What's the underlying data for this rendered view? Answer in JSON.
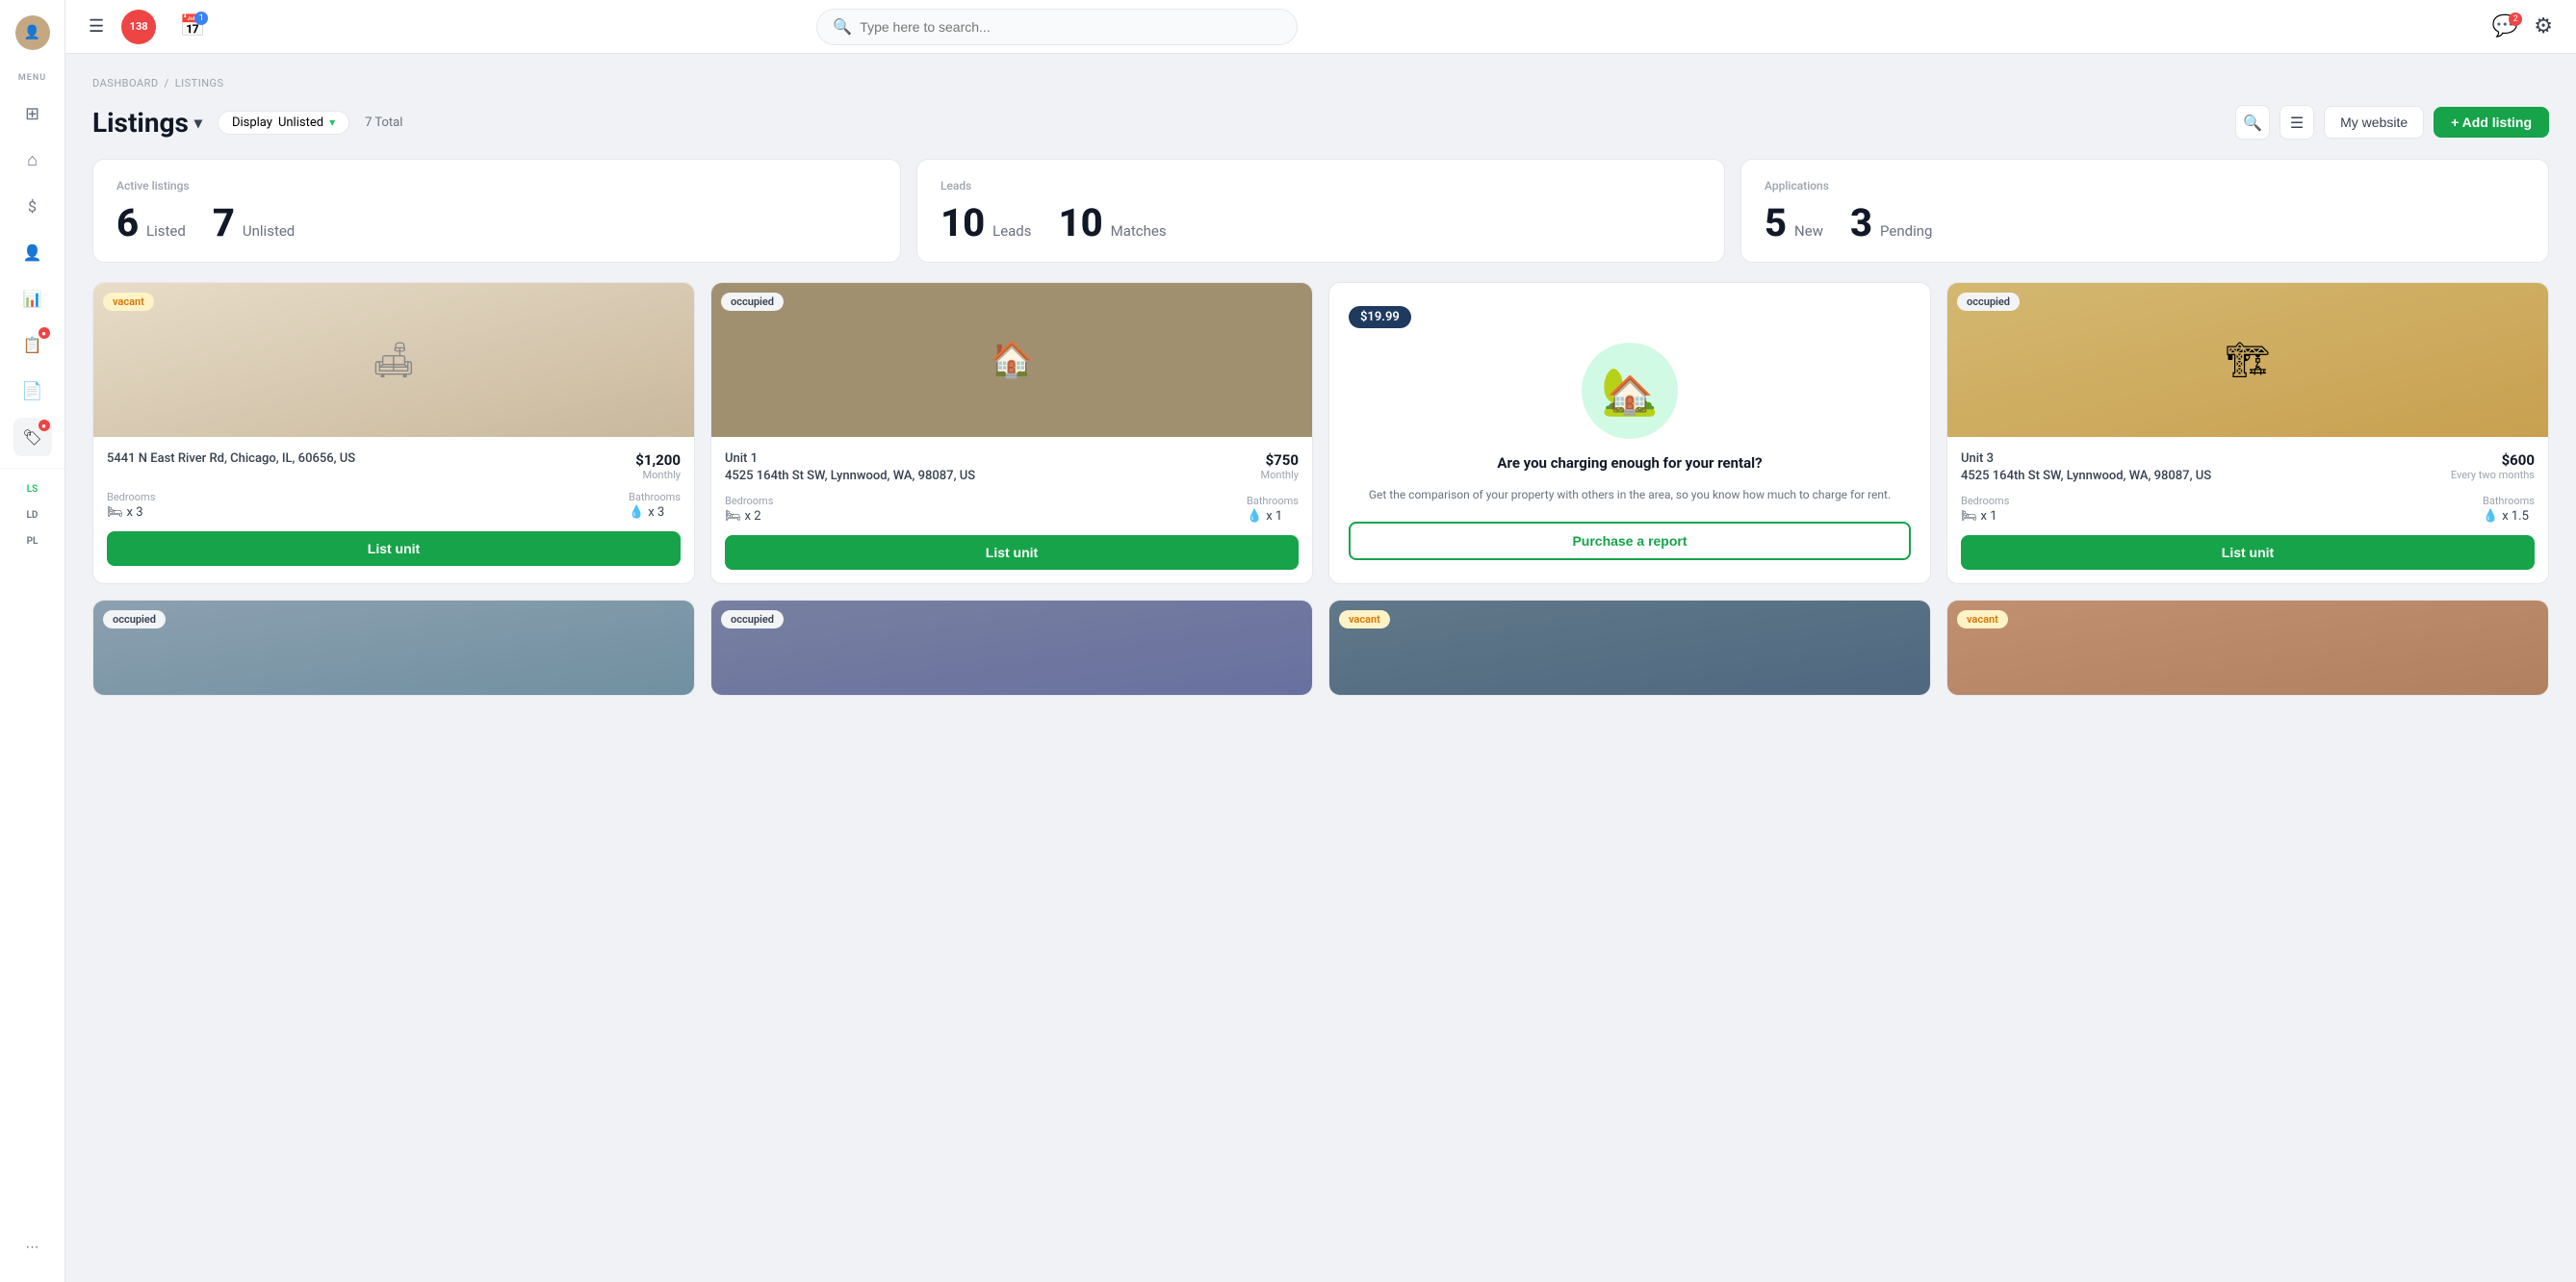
{
  "topbar": {
    "hamburger_label": "☰",
    "alert_count": "138",
    "calendar_badge": "1",
    "search_placeholder": "Type here to search...",
    "chat_badge": "2",
    "settings_label": "⚙"
  },
  "breadcrumb": {
    "dashboard": "DASHBOARD",
    "separator": "/",
    "current": "LISTINGS"
  },
  "page_header": {
    "title": "Listings",
    "chevron": "▾",
    "display_label": "Display",
    "display_value": "Unlisted",
    "filter_chevron": "▾",
    "total": "7 Total",
    "my_website": "My website",
    "add_listing": "+ Add listing"
  },
  "stats": {
    "active_listings": {
      "title": "Active listings",
      "listed_count": "6",
      "listed_label": "Listed",
      "unlisted_count": "7",
      "unlisted_label": "Unlisted"
    },
    "leads": {
      "title": "Leads",
      "leads_count": "10",
      "leads_label": "Leads",
      "matches_count": "10",
      "matches_label": "Matches"
    },
    "applications": {
      "title": "Applications",
      "new_count": "5",
      "new_label": "New",
      "pending_count": "3",
      "pending_label": "Pending"
    }
  },
  "listings": [
    {
      "id": "1",
      "badge": "vacant",
      "badge_type": "vacant",
      "address": "5441 N East River Rd, Chicago, IL, 60656, US",
      "price": "$1,200",
      "period": "Monthly",
      "bedrooms_label": "Bedrooms",
      "bedrooms_value": "x 3",
      "bathrooms_label": "Bathrooms",
      "bathrooms_value": "x 3",
      "action": "List unit",
      "bg_color": "#c8b8a0",
      "has_arrow": true
    },
    {
      "id": "2",
      "badge": "occupied",
      "badge_type": "occupied",
      "address": "Unit 1\n4525 164th St SW, Lynnwood, WA, 98087, US",
      "price": "$750",
      "period": "Monthly",
      "bedrooms_label": "Bedrooms",
      "bedrooms_value": "x 2",
      "bathrooms_label": "Bathrooms",
      "bathrooms_value": "x 1",
      "action": "List unit",
      "bg_color": "#b0a090",
      "has_arrow": false
    },
    {
      "id": "3",
      "is_promo": true,
      "promo_price": "$19.99",
      "promo_title": "Are you charging enough for your rental?",
      "promo_desc": "Get the comparison of your property with others in the area, so you know how much to charge for rent.",
      "action": "Purchase a report",
      "has_arrow": false
    },
    {
      "id": "4",
      "badge": "occupied",
      "badge_type": "occupied",
      "address": "Unit 3\n4525 164th St SW, Lynnwood, WA, 98087, US",
      "price": "$600",
      "period": "Every two months",
      "bedrooms_label": "Bedrooms",
      "bedrooms_value": "x 1",
      "bathrooms_label": "Bathrooms",
      "bathrooms_value": "x 1.5",
      "action": "List unit",
      "bg_color": "#c0a870",
      "has_arrow": false
    }
  ],
  "bottom_cards": [
    {
      "badge": "occupied",
      "badge_type": "occupied",
      "bg": "#8ca0b0"
    },
    {
      "badge": "occupied",
      "badge_type": "occupied",
      "bg": "#9090a0"
    },
    {
      "badge": "vacant",
      "badge_type": "vacant",
      "bg": "#707880"
    },
    {
      "badge": "vacant",
      "badge_type": "vacant",
      "bg": "#b09080"
    }
  ],
  "nav": {
    "menu_label": "MENU",
    "items": [
      {
        "icon": "⊞",
        "label": "dashboard",
        "active": false
      },
      {
        "icon": "⌂",
        "label": "home",
        "active": false
      },
      {
        "icon": "$",
        "label": "finance",
        "active": false
      },
      {
        "icon": "👤",
        "label": "users",
        "active": false
      },
      {
        "icon": "📊",
        "label": "analytics",
        "active": false
      },
      {
        "icon": "📋",
        "label": "reports",
        "active": false
      },
      {
        "icon": "📄",
        "label": "documents",
        "active": false
      },
      {
        "icon": "🏷",
        "label": "listings-nav",
        "active": true
      }
    ],
    "shortcuts": [
      {
        "label": "LS",
        "active": true
      },
      {
        "label": "LD",
        "active": false
      },
      {
        "label": "PL",
        "active": false
      }
    ]
  }
}
